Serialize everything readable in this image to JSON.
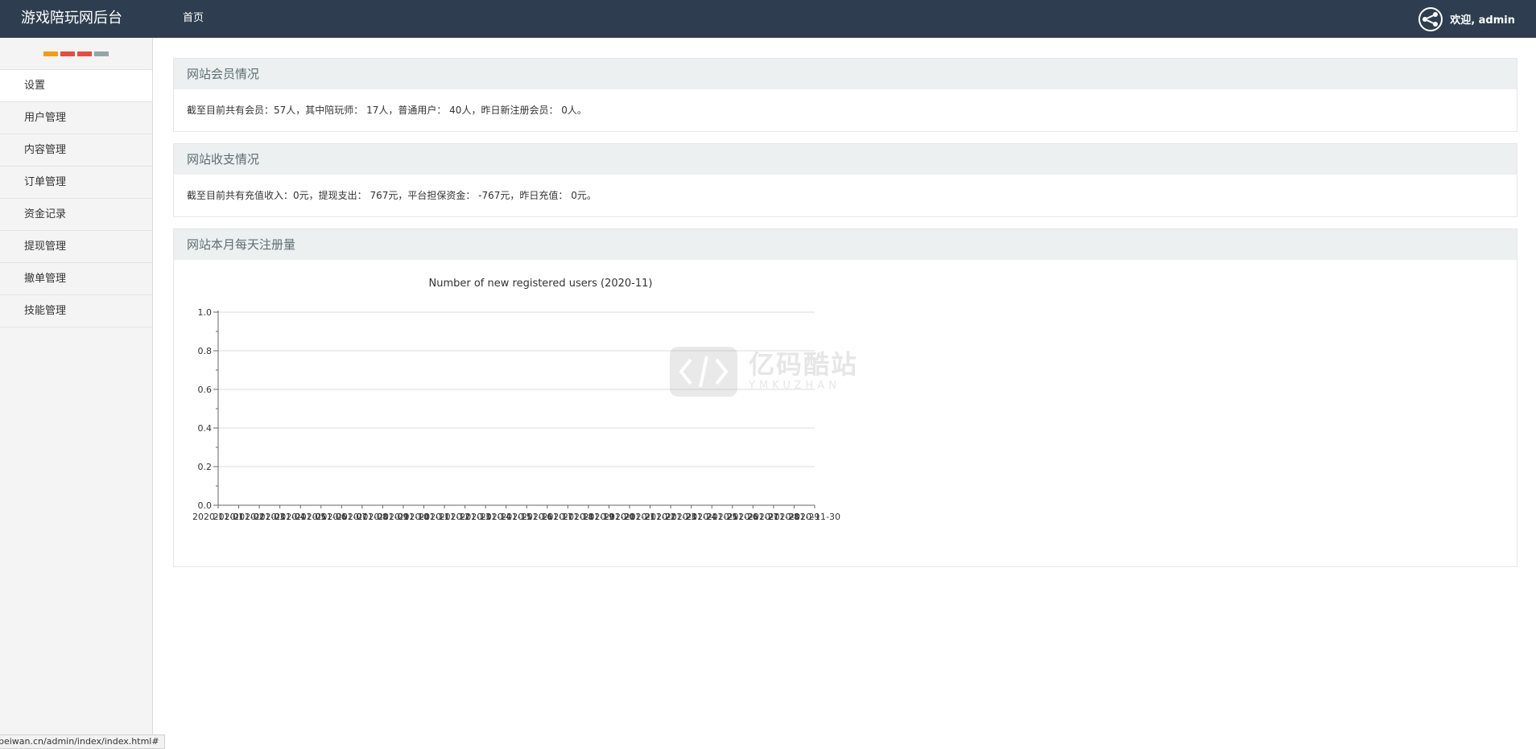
{
  "header": {
    "brand": "游戏陪玩网后台",
    "nav_home": "首页",
    "user_greeting": "欢迎, admin"
  },
  "sidebar": {
    "head_colors": [
      "#f39c12",
      "#e74c3c",
      "#e74c3c",
      "#95a5a6"
    ],
    "items": [
      {
        "label": "设置"
      },
      {
        "label": "用户管理"
      },
      {
        "label": "内容管理"
      },
      {
        "label": "订单管理"
      },
      {
        "label": "资金记录"
      },
      {
        "label": "提现管理"
      },
      {
        "label": "撤单管理"
      },
      {
        "label": "技能管理"
      }
    ]
  },
  "status_bar": {
    "url": "peiwan.cn/admin/index/index.html#"
  },
  "panels": {
    "members": {
      "title": "网站会员情况",
      "text": "截至目前共有会员：57人，其中陪玩师： 17人，普通用户： 40人，昨日新注册会员： 0人。"
    },
    "finance": {
      "title": "网站收支情况",
      "text": "截至目前共有充值收入：0元，提现支出： 767元，平台担保资金： -767元，昨日充值： 0元。"
    },
    "chart": {
      "title": "网站本月每天注册量"
    }
  },
  "watermark": {
    "cn": "亿码酷站",
    "en": "YMKUZHAN"
  },
  "colors": {
    "topbar": "#2e3e50",
    "panel_head": "#ecf0f1"
  },
  "chart_data": {
    "type": "line",
    "title": "Number of new registered users (2020-11)",
    "xlabel": "",
    "ylabel": "",
    "x": [
      "2020-11-01",
      "2020-11-02",
      "2020-11-03",
      "2020-11-04",
      "2020-11-05",
      "2020-11-06",
      "2020-11-07",
      "2020-11-08",
      "2020-11-09",
      "2020-11-10",
      "2020-11-11",
      "2020-11-12",
      "2020-11-13",
      "2020-11-14",
      "2020-11-15",
      "2020-11-16",
      "2020-11-17",
      "2020-11-18",
      "2020-11-19",
      "2020-11-20",
      "2020-11-21",
      "2020-11-22",
      "2020-11-23",
      "2020-11-24",
      "2020-11-25",
      "2020-11-26",
      "2020-11-27",
      "2020-11-28",
      "2020-11-29",
      "2020-11-30"
    ],
    "series": [
      {
        "values": [
          0,
          0,
          0,
          0,
          0,
          0,
          0,
          0,
          0,
          0,
          0,
          0,
          0,
          0,
          0,
          0,
          0,
          0,
          0,
          0,
          0,
          0,
          0,
          0,
          0,
          0,
          0,
          0,
          0,
          0
        ]
      }
    ],
    "yticks": [
      "0.0",
      "0.2",
      "0.4",
      "0.6",
      "0.8",
      "1.0"
    ],
    "ylim": [
      0,
      1
    ],
    "grid": true
  }
}
